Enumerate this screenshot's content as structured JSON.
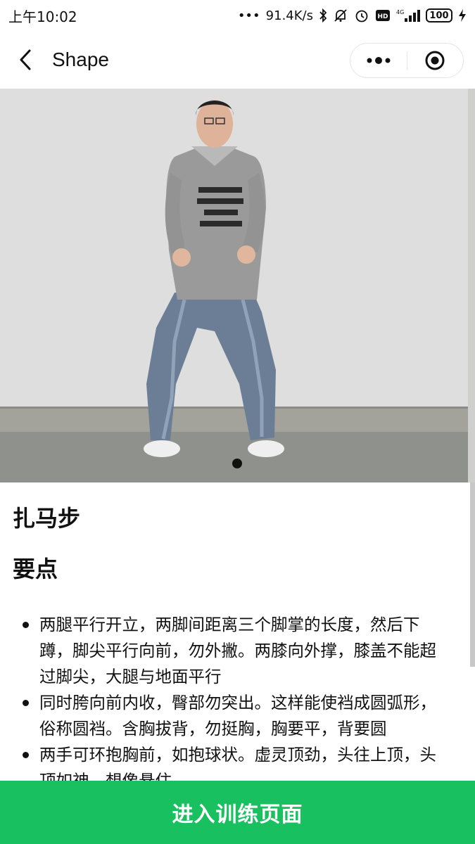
{
  "status_bar": {
    "time": "上午10:02",
    "network_speed": "91.4K/s",
    "signal_label": "4G",
    "hd_label": "HD",
    "battery": "100"
  },
  "nav": {
    "title": "Shape"
  },
  "hero": {
    "slide_count": 1,
    "active_slide": 1
  },
  "content": {
    "pose_name": "扎马步",
    "section_title": "要点",
    "tips": [
      "两腿平行开立，两脚间距离三个脚掌的长度，然后下蹲，脚尖平行向前，勿外撇。两膝向外撑，膝盖不能超过脚尖，大腿与地面平行",
      "同时胯向前内收，臀部勿突出。这样能使裆成圆弧形，俗称圆裆。含胸拔背，勿挺胸，胸要平，背要圆",
      "两手可环抱胸前，如抱球状。虚灵顶劲，头往上顶，头顶如神，想像悬住"
    ]
  },
  "footer": {
    "enter_label": "进入训练页面"
  },
  "colors": {
    "primary_green": "#18c060",
    "text": "#111111",
    "wall": "#dcdcda",
    "floor": "#8f918c"
  }
}
